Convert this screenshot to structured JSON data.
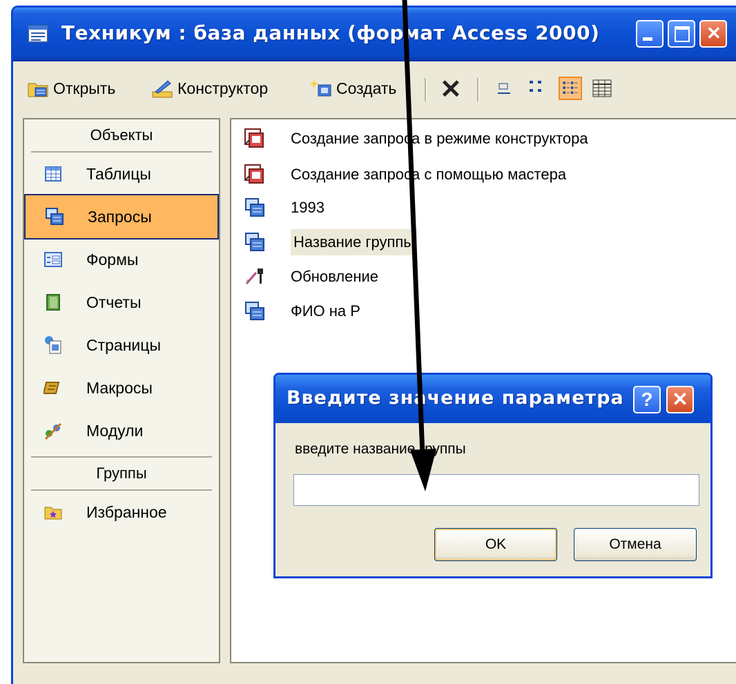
{
  "window": {
    "title": "Техникум : база данных (формат Access 2000)",
    "icon": "database-window-icon"
  },
  "toolbar": {
    "open_label": "Открыть",
    "design_label": "Конструктор",
    "create_label": "Создать",
    "delete_icon": "delete-x-icon",
    "view_icons": [
      "large-icons-view",
      "small-icons-view",
      "list-view",
      "details-view"
    ],
    "active_view": "list-view"
  },
  "sidebar": {
    "objects_header": "Объекты",
    "items": [
      {
        "label": "Таблицы",
        "icon": "table-icon"
      },
      {
        "label": "Запросы",
        "icon": "query-icon",
        "selected": true
      },
      {
        "label": "Формы",
        "icon": "form-icon"
      },
      {
        "label": "Отчеты",
        "icon": "report-icon"
      },
      {
        "label": "Страницы",
        "icon": "page-icon"
      },
      {
        "label": "Макросы",
        "icon": "macro-icon"
      },
      {
        "label": "Модули",
        "icon": "module-icon"
      }
    ],
    "groups_header": "Группы",
    "groups": [
      {
        "label": "Избранное",
        "icon": "favorites-folder-icon"
      }
    ]
  },
  "list": {
    "items": [
      {
        "label": "Создание запроса в режиме конструктора",
        "icon": "wizard-shortcut-icon"
      },
      {
        "label": "Создание запроса с помощью мастера",
        "icon": "wizard-shortcut-icon"
      },
      {
        "label": "1993",
        "icon": "select-query-icon"
      },
      {
        "label": "Название группы",
        "icon": "select-query-icon",
        "highlighted": true
      },
      {
        "label": "Обновление",
        "icon": "update-query-icon"
      },
      {
        "label": "ФИО на Р",
        "icon": "select-query-icon"
      }
    ]
  },
  "dialog": {
    "title": "Введите значение параметра",
    "help_label": "?",
    "prompt": "введите название группы",
    "input_value": "",
    "ok_label": "OK",
    "cancel_label": "Отмена"
  },
  "colors": {
    "titlebar_blue": "#0a4fd2",
    "selection_orange": "#ffb760",
    "close_red": "#d34c24",
    "panel_beige": "#ece9d8"
  }
}
